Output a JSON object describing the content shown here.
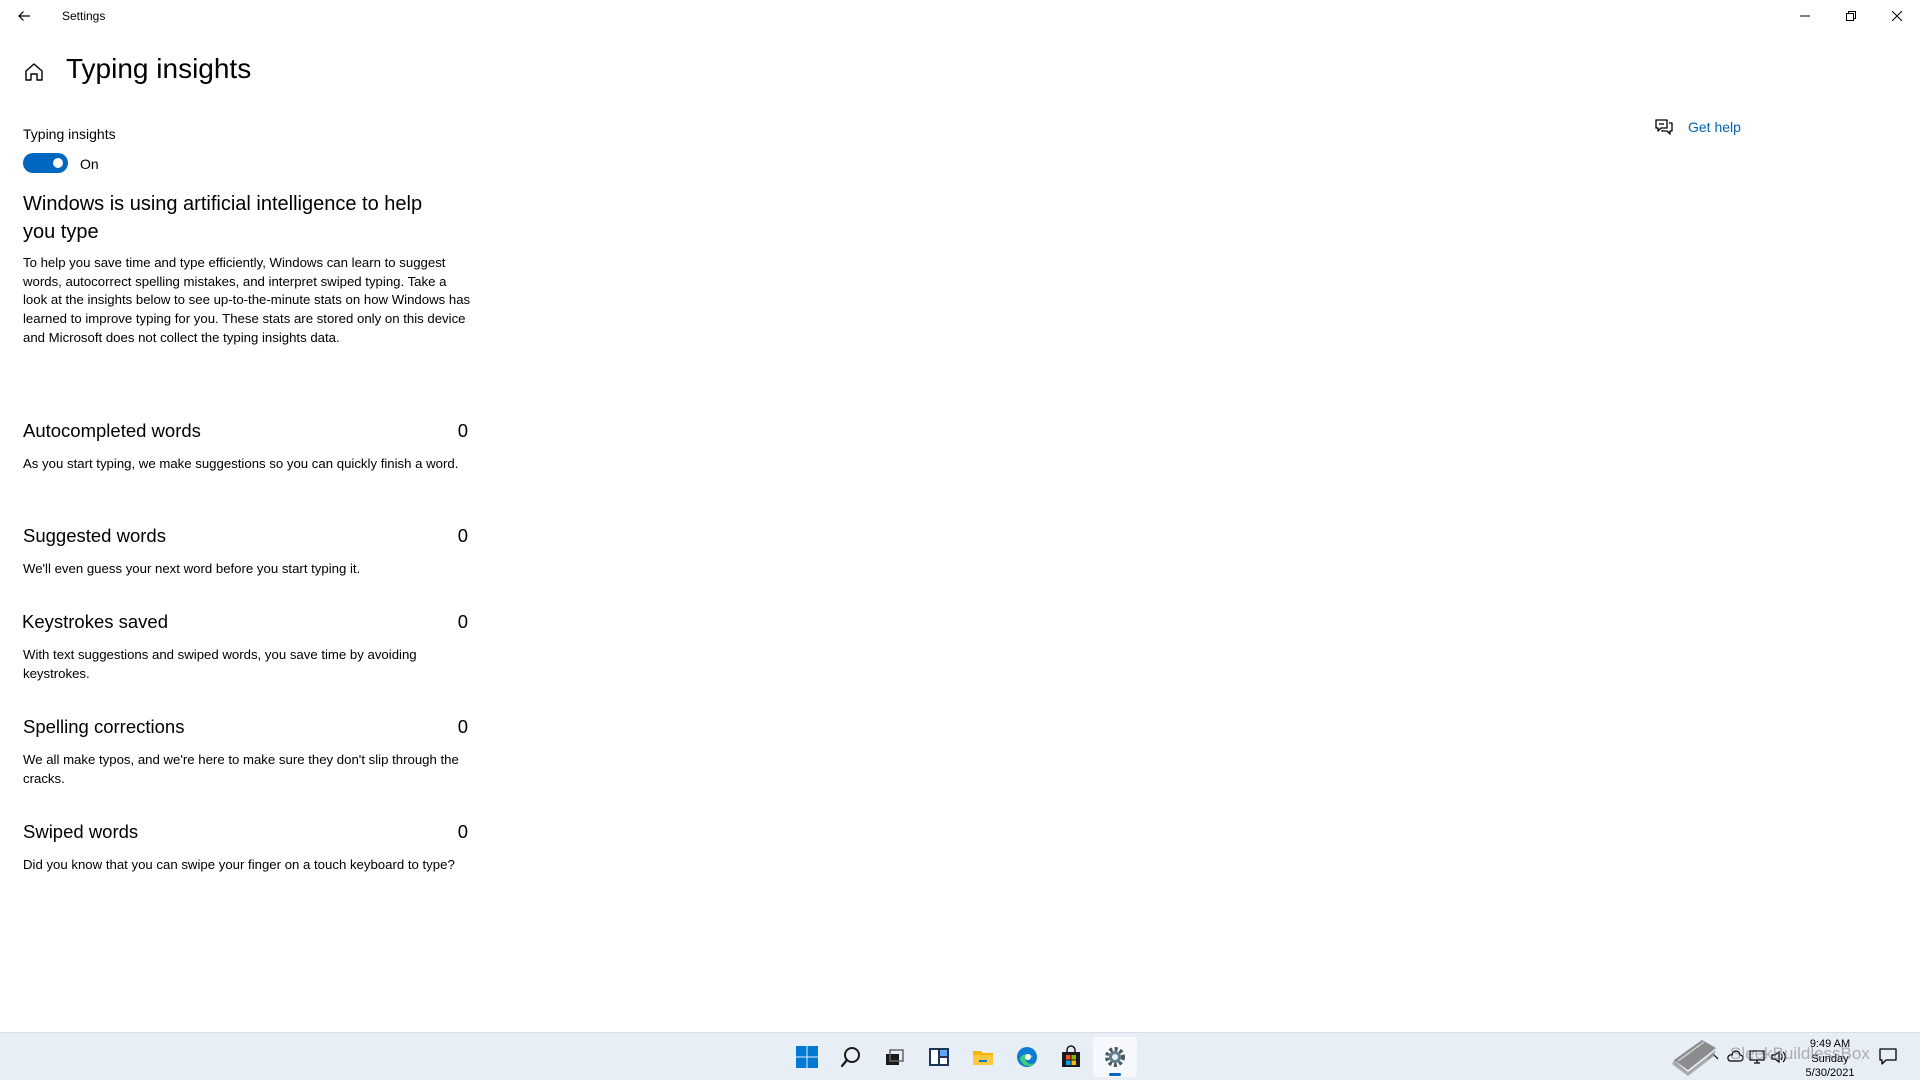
{
  "window": {
    "title": "Settings"
  },
  "page": {
    "title": "Typing insights"
  },
  "toggle": {
    "label": "Typing insights",
    "state_label": "On",
    "is_on": true
  },
  "ai_section": {
    "heading": "Windows is using artificial intelligence to help you type",
    "description": "To help you save time and type efficiently, Windows can learn to suggest words, autocorrect spelling mistakes, and interpret swiped typing. Take a look at the insights below to see up-to-the-minute stats on how Windows has learned to improve typing for you. These stats are stored only on this device and Microsoft does not collect the typing insights data."
  },
  "stats": [
    {
      "title": "Autocompleted words",
      "value": "0",
      "description": "As you start typing, we make suggestions so you can quickly finish a word."
    },
    {
      "title": "Suggested words",
      "value": "0",
      "description": "We'll even guess your next word before you start typing it."
    },
    {
      "title": "Keystrokes saved",
      "value": "0",
      "description": "With text suggestions and swiped words, you save time by avoiding keystrokes."
    },
    {
      "title": "Spelling corrections",
      "value": "0",
      "description": "We all make typos, and we're here to make sure they don't slip through the cracks."
    },
    {
      "title": "Swiped words",
      "value": "0",
      "description": "Did you know that you can swipe your finger on a touch keyboard to type?"
    }
  ],
  "help": {
    "label": "Get help"
  },
  "taskbar": {
    "icons": [
      "start-icon",
      "search-icon",
      "task-view-icon",
      "widgets-icon",
      "file-explorer-icon",
      "edge-icon",
      "store-icon",
      "settings-icon"
    ],
    "active": "settings-icon",
    "accent": "#0067c0"
  },
  "clock": {
    "time": "9:49 AM",
    "day": "Sunday",
    "date": "5/30/2021"
  },
  "watermark": {
    "text": "SleekBuildlessBox"
  }
}
